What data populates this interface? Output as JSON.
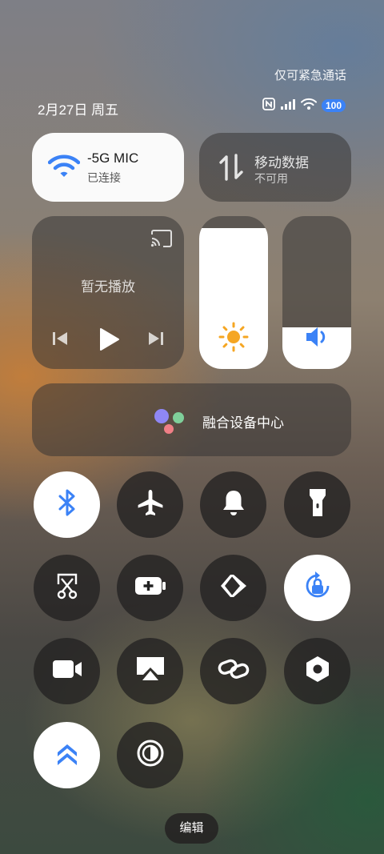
{
  "status_bar": {
    "emergency_text": "仅可紧急通话",
    "date_text": "2月27日 周五",
    "battery_level": "100"
  },
  "wifi_tile": {
    "network_name": "-5G MIC",
    "status": "已连接",
    "active": true
  },
  "mobile_data_tile": {
    "title": "移动数据",
    "status": "不可用",
    "active": false
  },
  "media_tile": {
    "status": "暂无播放"
  },
  "sliders": {
    "brightness_level": 0.92,
    "volume_level": 0.27
  },
  "device_hub": {
    "label": "融合设备中心"
  },
  "toggles": [
    {
      "id": "bluetooth",
      "icon": "bluetooth-icon",
      "active": true
    },
    {
      "id": "airplane",
      "icon": "airplane-icon",
      "active": false
    },
    {
      "id": "ringer",
      "icon": "bell-icon",
      "active": false
    },
    {
      "id": "flashlight",
      "icon": "flashlight-icon",
      "active": false
    },
    {
      "id": "screenshot",
      "icon": "scissors-screenshot-icon",
      "active": false
    },
    {
      "id": "battery-saver",
      "icon": "battery-plus-icon",
      "active": false
    },
    {
      "id": "share",
      "icon": "share-arrows-icon",
      "active": false
    },
    {
      "id": "rotation-lock",
      "icon": "rotation-lock-icon",
      "active": true
    },
    {
      "id": "screen-record",
      "icon": "video-camera-icon",
      "active": false
    },
    {
      "id": "screen-cast",
      "icon": "airplay-icon",
      "active": false
    },
    {
      "id": "link",
      "icon": "link-icon",
      "active": false
    },
    {
      "id": "settings",
      "icon": "hexagon-nut-icon",
      "active": false
    },
    {
      "id": "performance",
      "icon": "double-chevron-up-icon",
      "active": true
    },
    {
      "id": "dark-mode",
      "icon": "contrast-icon",
      "active": false
    }
  ],
  "edit_label": "编辑",
  "colors": {
    "accent_blue": "#3b82f6",
    "sun_orange": "#f5a623"
  }
}
